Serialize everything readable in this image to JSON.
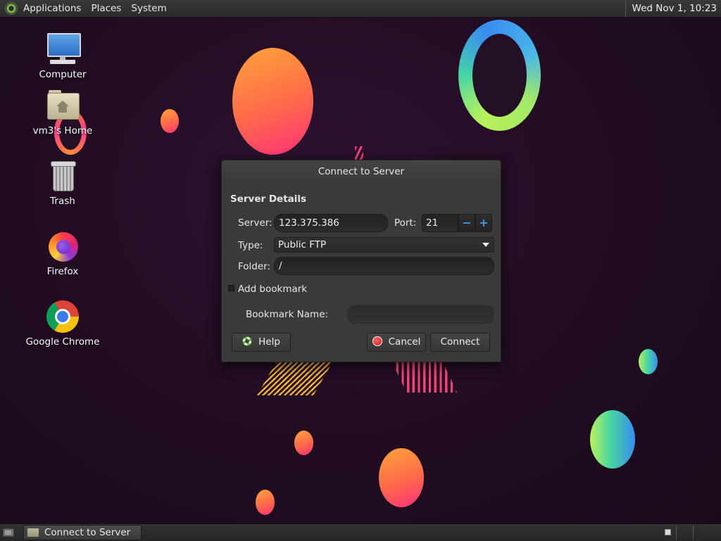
{
  "top_panel": {
    "menus": [
      "Applications",
      "Places",
      "System"
    ],
    "clock": "Wed Nov  1, 10:23"
  },
  "desktop": {
    "icons": [
      {
        "label": "Computer",
        "icon": "computer-icon"
      },
      {
        "label": "vm3's Home",
        "icon": "home-folder-icon"
      },
      {
        "label": "Trash",
        "icon": "trash-icon"
      },
      {
        "label": "Firefox",
        "icon": "firefox-icon"
      },
      {
        "label": "Google Chrome",
        "icon": "chrome-icon"
      }
    ]
  },
  "dialog": {
    "title": "Connect to Server",
    "section_header": "Server Details",
    "server_label": "Server:",
    "server_value": "123.375.386",
    "port_label": "Port:",
    "port_value": "21",
    "port_decrement": "−",
    "port_increment": "+",
    "type_label": "Type:",
    "type_value": "Public FTP",
    "folder_label": "Folder:",
    "folder_value": "/",
    "add_bookmark_label": "Add bookmark",
    "add_bookmark_checked": false,
    "bookmark_name_label": "Bookmark Name:",
    "bookmark_name_value": "",
    "help_label": "Help",
    "cancel_label": "Cancel",
    "connect_label": "Connect"
  },
  "bottom_panel": {
    "tasks": [
      {
        "label": "Connect to Server",
        "active": true
      }
    ]
  },
  "colors": {
    "panel": "#2f2f2f",
    "dialog_bg": "#3a3a3a",
    "accent_blue": "#4a90e2",
    "wallpaper": "#231026"
  }
}
